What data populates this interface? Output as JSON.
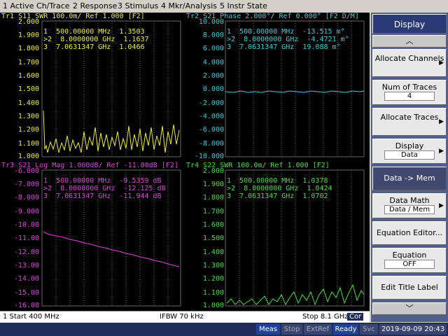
{
  "menu": [
    "1 Active Ch/Trace",
    "2 Response",
    "3 Stimulus",
    "4 Mkr/Analysis",
    "5 Instr State"
  ],
  "traces": [
    {
      "header": "Tr1 S11 SWR 100.0m/ Ref 1.000 [F2]",
      "color": "#f0f020",
      "ylabels": [
        "2.000",
        "1.900",
        "1.800",
        "1.700",
        "1.600",
        "1.500",
        "1.400",
        "1.300",
        "1.200",
        "1.100",
        "1.000"
      ],
      "markers": [
        "1  500.00000 MHz  1.3503",
        ">2  8.0000000 GHz  1.1637",
        "3  7.0631347 GHz  1.0466"
      ]
    },
    {
      "header": "Tr2 S21 Phase 2.000°/ Ref 0.000° [F2 D/M]",
      "color": "#30d0e0",
      "ylabels": [
        "10.000",
        "8.000",
        "6.000",
        "4.000",
        "2.000",
        "0.000",
        "-2.000",
        "-4.000",
        "-6.000",
        "-8.000",
        "-10.000"
      ],
      "markers": [
        "1  500.00000 MHz  -13.515 m°",
        ">2  8.0000000 GHz  -4.4721 m°",
        "3  7.0631347 GHz  19.088 m°"
      ]
    },
    {
      "header": "Tr3 S21 Log Mag 1.000dB/ Ref -11.00dB [F2]",
      "color": "#e040e0",
      "ylabels": [
        "-6.000",
        "-7.000",
        "-8.000",
        "-9.000",
        "-10.00",
        "-11.00",
        "-12.00",
        "-13.00",
        "-14.00",
        "-15.00",
        "-16.00"
      ],
      "markers": [
        "1  500.00000 MHz  -9.5359 dB",
        ">2  8.0000000 GHz  -12.125 dB",
        "3  7.0631347 GHz  -11.944 dB"
      ]
    },
    {
      "header": "Tr4 S22 SWR 100.0m/ Ref 1.000 [F2]",
      "color": "#40e040",
      "ylabels": [
        "2.000",
        "1.900",
        "1.800",
        "1.700",
        "1.600",
        "1.500",
        "1.400",
        "1.300",
        "1.200",
        "1.100",
        "1.000"
      ],
      "markers": [
        "1  500.00000 MHz  1.0378",
        ">2  8.0000000 GHz  1.0424",
        "3  7.0631347 GHz  1.0702"
      ]
    }
  ],
  "status": {
    "start": "1  Start 400 MHz",
    "ifbw": "IFBW 70 kHz",
    "stop": "Stop 8.1 GHz",
    "cor": "Cor"
  },
  "bottom": {
    "meas": "Meas",
    "stop": "Stop",
    "extref": "ExtRef",
    "ready": "Ready",
    "svc": "Svc",
    "datetime": "2019-09-09 20:43"
  },
  "softkeys": {
    "title": "Display",
    "allocate_channels": "Allocate Channels",
    "num_traces_label": "Num of Traces",
    "num_traces_value": "4",
    "allocate_traces": "Allocate Traces",
    "display_label": "Display",
    "display_value": "Data",
    "data_mem": "Data -> Mem",
    "data_math_label": "Data Math",
    "data_math_value": "Data / Mem",
    "equation_editor": "Equation Editor...",
    "equation_label": "Equation",
    "equation_value": "OFF",
    "edit_title": "Edit Title Label"
  }
}
